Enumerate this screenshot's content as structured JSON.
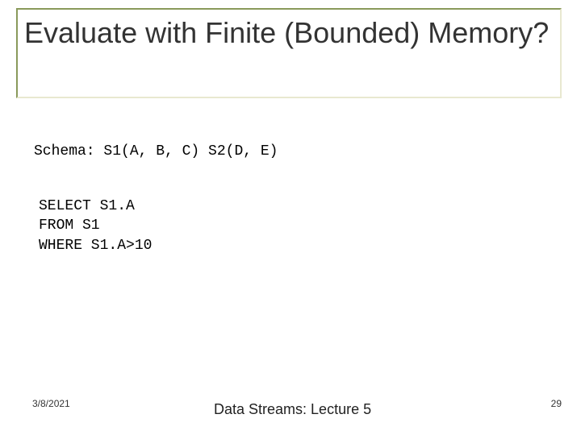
{
  "title": "Evaluate with Finite (Bounded) Memory?",
  "schema_line": "Schema: S1(A, B, C)    S2(D, E)",
  "query": "SELECT S1.A\nFROM S1\nWHERE S1.A>10",
  "footer": {
    "date": "3/8/2021",
    "center": "Data Streams: Lecture 5",
    "page": "29"
  }
}
